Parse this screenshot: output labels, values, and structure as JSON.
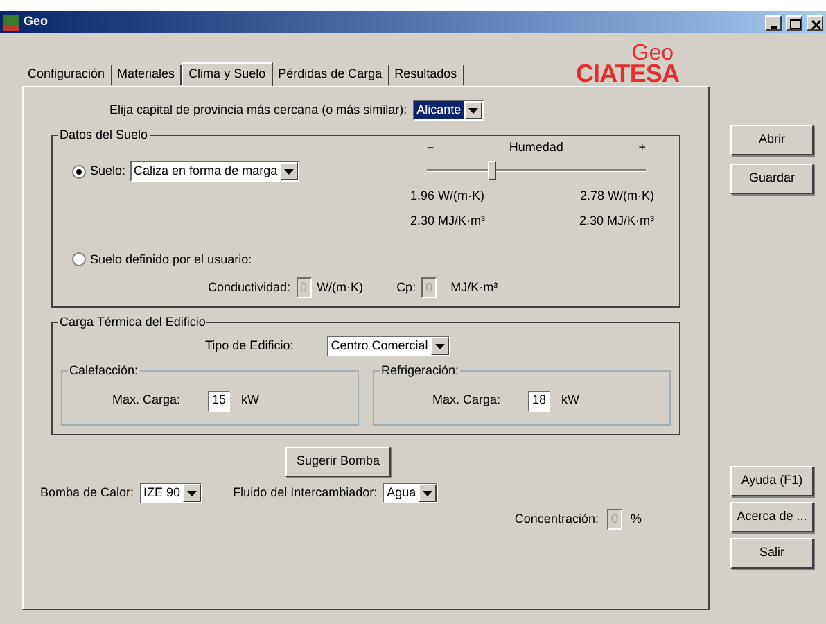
{
  "window": {
    "title": "Geo"
  },
  "tabs": [
    {
      "label": "Configuración",
      "selected": false
    },
    {
      "label": "Materiales",
      "selected": false
    },
    {
      "label": "Clima y Suelo",
      "selected": true
    },
    {
      "label": "Pérdidas de Carga",
      "selected": false
    },
    {
      "label": "Resultados",
      "selected": false
    }
  ],
  "logo": {
    "top": "Geo",
    "bottom": "CIATESA"
  },
  "capital": {
    "label": "Elija capital de provincia más cercana (o más similar):",
    "value": "Alicante"
  },
  "soil": {
    "title": "Datos del Suelo",
    "options": [
      {
        "label": "Suelo:",
        "selected": true
      },
      {
        "label": "Suelo definido por el usuario:",
        "selected": false
      }
    ],
    "soil_type": "Caliza en forma de marga",
    "humidity": {
      "minus": "–",
      "label": "Humedad",
      "plus": "+",
      "level": 0.3
    },
    "readings": [
      [
        "1.96  W/(m·K)",
        "2.78  W/(m·K)"
      ],
      [
        "2.30  MJ/K·m³",
        "2.30  MJ/K·m³"
      ]
    ],
    "conductivity": {
      "label": "Conductividad:",
      "value": "0",
      "unit": "W/(m·K)",
      "disabled": true
    },
    "cp": {
      "label": "Cp:",
      "value": "0",
      "unit": "MJ/K·m³",
      "disabled": true
    }
  },
  "load": {
    "title": "Carga Térmica del Edificio",
    "building_label": "Tipo de Edificio:",
    "building": "Centro Comercial",
    "groups": [
      {
        "title": "Calefacción:",
        "label": "Max. Carga:",
        "value": "15",
        "unit": "kW"
      },
      {
        "title": "Refrigeración:",
        "label": "Max. Carga:",
        "value": "18",
        "unit": "kW"
      }
    ]
  },
  "suggest_button": "Sugerir Bomba",
  "pump": {
    "label": "Bomba de Calor:",
    "value": "IZE 90"
  },
  "fluid": {
    "label": "Fluido del Intercambiador:",
    "value": "Agua"
  },
  "concentration": {
    "label": "Concentración:",
    "value": "0",
    "unit": "%",
    "disabled": true
  },
  "side_buttons_top": [
    "Abrir",
    "Guardar"
  ],
  "side_buttons_bottom": [
    "Ayuda (F1)",
    "Acerca de ...",
    "Salir"
  ]
}
